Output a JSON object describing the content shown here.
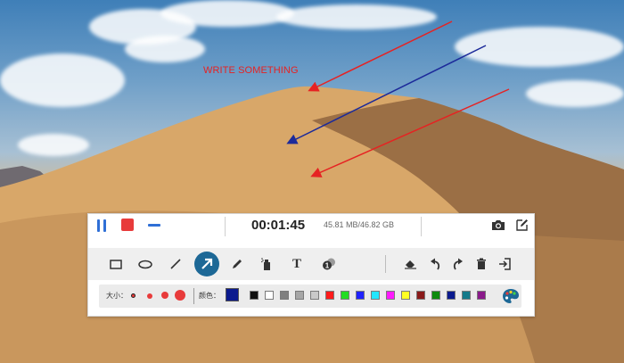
{
  "annotation": {
    "text": "WRITE SOMETHING",
    "color": "#e62222"
  },
  "arrows": [
    {
      "name": "red-arrow-top",
      "color": "#e62222"
    },
    {
      "name": "blue-arrow",
      "color": "#1c2a9a"
    },
    {
      "name": "red-arrow-bottom",
      "color": "#e62222"
    }
  ],
  "toolbar": {
    "status": {
      "timer": "00:01:45",
      "storage": "45.81 MB/46.82 GB"
    },
    "controls": [
      "pause-icon",
      "stop-icon",
      "minimize-icon",
      "camera-icon",
      "edit-icon"
    ],
    "tools": [
      "rectangle",
      "ellipse",
      "line",
      "arrow",
      "pencil",
      "spray",
      "text",
      "number-marker",
      "eraser",
      "undo",
      "redo",
      "delete",
      "exit"
    ],
    "selected_tool": "arrow",
    "size": {
      "label": "大小：",
      "options": [
        "xs",
        "s",
        "m",
        "l"
      ]
    },
    "color": {
      "label": "颜色：",
      "selected": "#0b1a8e",
      "palette": [
        "#111111",
        "#ffffff",
        "#7f7f7f",
        "#a6a6a6",
        "#c9c9c9",
        "#ff1a1a",
        "#22dd22",
        "#1f22ff",
        "#22e6ff",
        "#ff1aff",
        "#ffff22",
        "#8a1a1a",
        "#0e8a0e",
        "#0b1a8e",
        "#157a8a",
        "#8a1a8a"
      ]
    },
    "accent_color": "#1d6896"
  }
}
